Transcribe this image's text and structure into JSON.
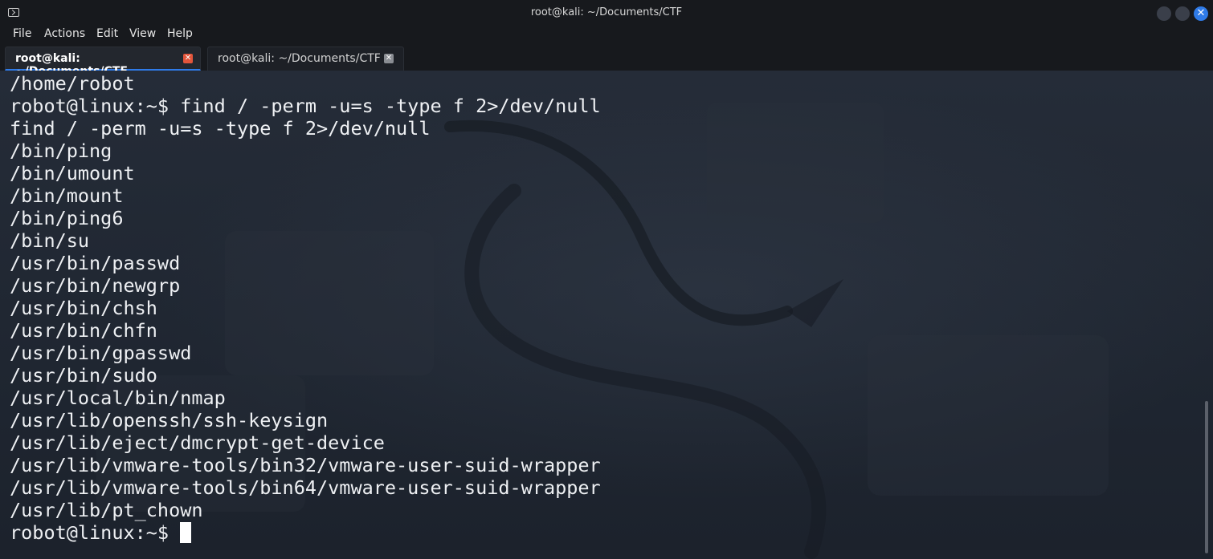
{
  "window": {
    "title": "root@kali: ~/Documents/CTF",
    "icon": "terminal-icon",
    "controls": {
      "minimize_icon": "circle",
      "maximize_icon": "circle",
      "close_icon": "✕"
    }
  },
  "menu": [
    "File",
    "Actions",
    "Edit",
    "View",
    "Help"
  ],
  "tabs": [
    {
      "label": "root@kali: ~/Documents/CTF",
      "close": "✕",
      "active": true
    },
    {
      "label": "root@kali: ~/Documents/CTF",
      "close": "✕",
      "active": false
    }
  ],
  "terminal": {
    "lines": [
      "/home/robot",
      "robot@linux:~$ find / -perm -u=s -type f 2>/dev/null",
      "find / -perm -u=s -type f 2>/dev/null",
      "/bin/ping",
      "/bin/umount",
      "/bin/mount",
      "/bin/ping6",
      "/bin/su",
      "/usr/bin/passwd",
      "/usr/bin/newgrp",
      "/usr/bin/chsh",
      "/usr/bin/chfn",
      "/usr/bin/gpasswd",
      "/usr/bin/sudo",
      "/usr/local/bin/nmap",
      "/usr/lib/openssh/ssh-keysign",
      "/usr/lib/eject/dmcrypt-get-device",
      "/usr/lib/vmware-tools/bin32/vmware-user-suid-wrapper",
      "/usr/lib/vmware-tools/bin64/vmware-user-suid-wrapper",
      "/usr/lib/pt_chown"
    ],
    "prompt": "robot@linux:~$"
  },
  "colors": {
    "chrome_bg": "#17191d",
    "terminal_bg": "#1f2530",
    "text": "#eef0f3",
    "accent": "#2f7be8",
    "tab_close_active": "#e2553b"
  }
}
